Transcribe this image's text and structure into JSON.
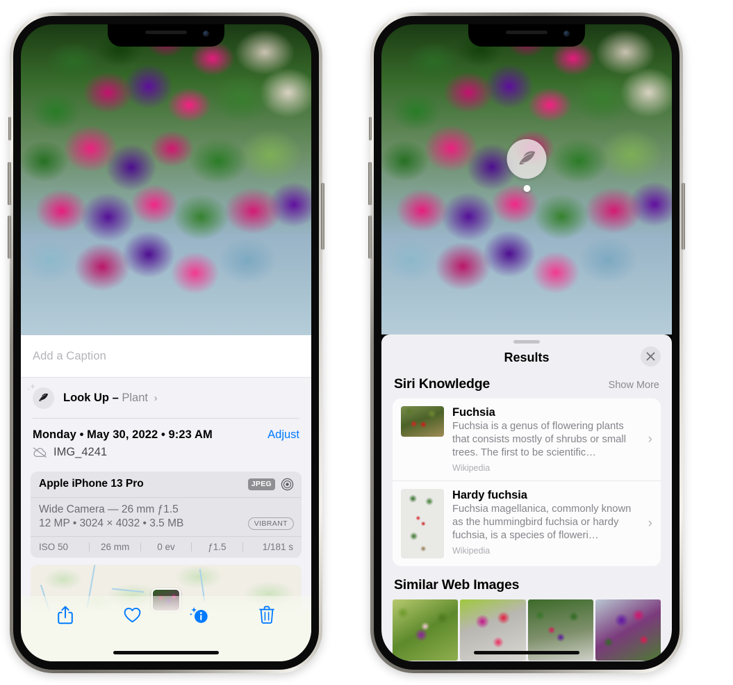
{
  "left_phone": {
    "name": "photo-detail-screen",
    "caption": {
      "placeholder": "Add a Caption",
      "value": ""
    },
    "lookup_row": {
      "icon": "leaf-icon",
      "sparkle_icon": "sparkle-icon",
      "label": "Look Up –",
      "subject": "Plant",
      "chevron": "›"
    },
    "meta": {
      "datetime": "Monday • May 30, 2022 • 9:23 AM",
      "adjust_label": "Adjust",
      "cloud_icon": "cloud-slash-icon",
      "filename": "IMG_4241"
    },
    "camera_card": {
      "model": "Apple iPhone 13 Pro",
      "format_tag": "JPEG",
      "lens_icon": "aperture-icon",
      "lens": "Wide Camera — 26 mm ƒ1.5",
      "specs": "12 MP • 3024 × 4032 • 3.5 MB",
      "style_tag": "VIBRANT",
      "exif": [
        "ISO 50",
        "26 mm",
        "0 ev",
        "ƒ1.5",
        "1/181 s"
      ]
    },
    "map": {
      "name": "location-map",
      "pin": "photo-pin"
    },
    "toolbar": [
      {
        "name": "share-button",
        "icon": "share-icon"
      },
      {
        "name": "favorite-button",
        "icon": "heart-icon"
      },
      {
        "name": "info-button",
        "icon": "info-sparkle-icon"
      },
      {
        "name": "delete-button",
        "icon": "trash-icon"
      }
    ],
    "accent_color": "#007aff"
  },
  "right_phone": {
    "name": "visual-look-up-results-screen",
    "badge": {
      "icon": "leaf-icon",
      "name": "visual-look-up-badge"
    },
    "sheet": {
      "title": "Results",
      "close_icon": "close-icon",
      "sections": [
        {
          "title": "Siri Knowledge",
          "action": "Show More",
          "items": [
            {
              "title": "Fuchsia",
              "description": "Fuchsia is a genus of flowering plants that consists mostly of shrubs or small trees. The first to be scientific…",
              "source": "Wikipedia",
              "thumb": "fuchsia-red-flowers-thumbnail",
              "chevron": "›"
            },
            {
              "title": "Hardy fuchsia",
              "description": "Fuchsia magellanica, commonly known as the hummingbird fuchsia or hardy fuchsia, is a species of floweri…",
              "source": "Wikipedia",
              "thumb": "hardy-fuchsia-specimen-thumbnail",
              "chevron": "›"
            }
          ]
        },
        {
          "title": "Similar Web Images",
          "thumbnails": [
            "fuchsia-pink-purple-thumbnail",
            "fuchsia-red-closeup-thumbnail",
            "fuchsia-bush-thumbnail",
            "fuchsia-purple-hanging-thumbnail"
          ]
        }
      ]
    }
  }
}
